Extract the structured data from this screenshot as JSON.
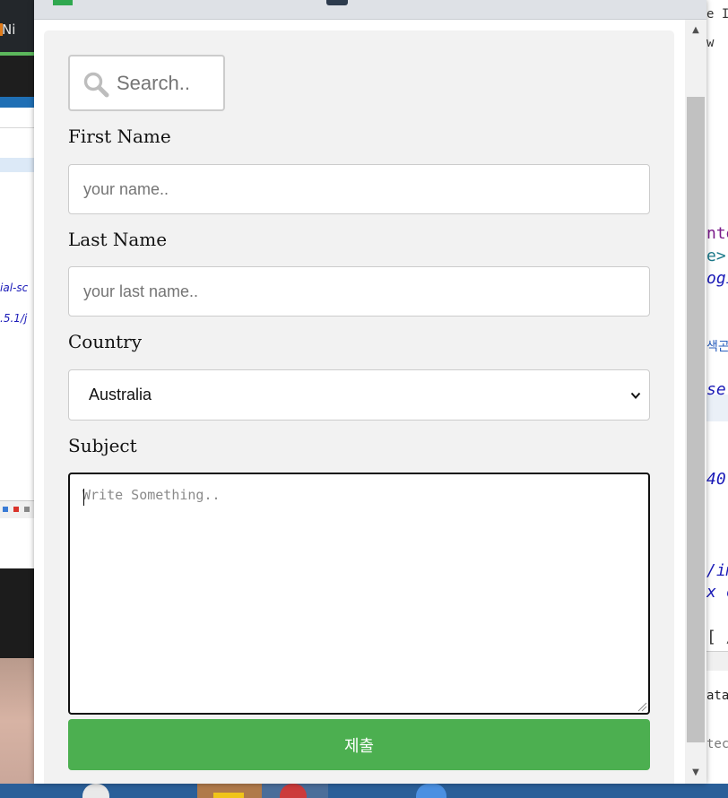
{
  "form": {
    "search": {
      "placeholder": "Search.."
    },
    "first_name": {
      "label": "First Name",
      "placeholder": "your name.."
    },
    "last_name": {
      "label": "Last Name",
      "placeholder": "your last name.."
    },
    "country": {
      "label": "Country",
      "selected": "Australia"
    },
    "subject": {
      "label": "Subject",
      "placeholder": "Write Something.."
    },
    "submit_label": "제출"
  },
  "colors": {
    "submit": "#4caf50",
    "card": "#f2f2f2",
    "input_border": "#cccccc"
  },
  "icons": {
    "search": "magnifier-icon",
    "select": "chevron-down-icon",
    "scroll_up": "triangle-up-icon",
    "scroll_down": "triangle-down-icon"
  },
  "background": {
    "left_fragments": [
      "Ni",
      "ial-sc",
      ".5.1/j"
    ],
    "right_fragments": [
      "e ID",
      "w",
      "nte",
      "e>",
      "ogi",
      "색곤",
      "se-",
      "40",
      "/im",
      "x c",
      "[ /",
      "ata",
      "tec"
    ]
  }
}
